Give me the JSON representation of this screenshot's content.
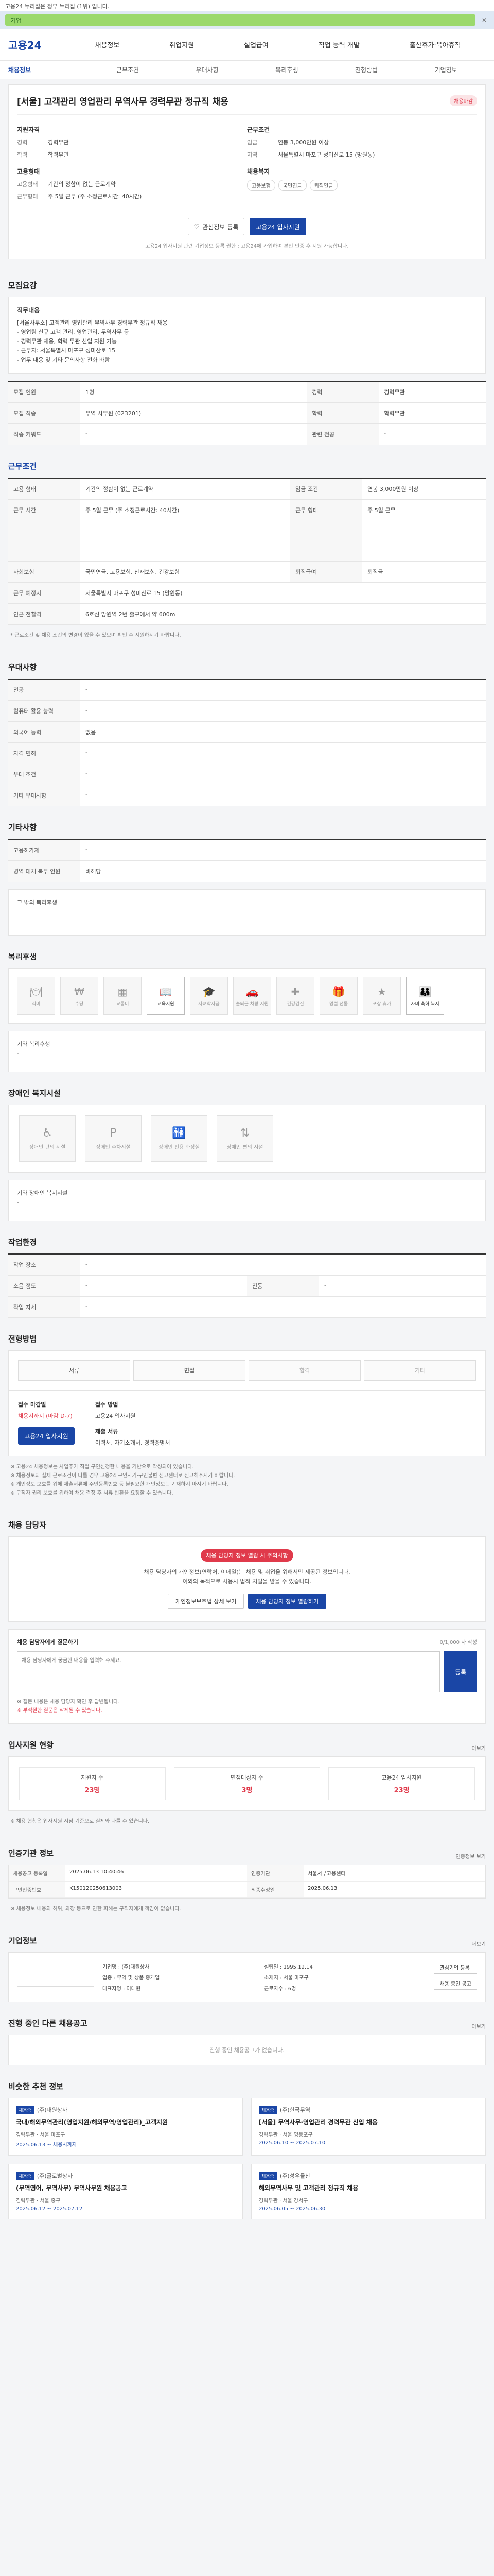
{
  "notice": "고용24 누리집은 정부 누리집 (1위) 입니다.",
  "ad": "기업",
  "header": {
    "logo": "고용24",
    "menu": [
      "채용정보",
      "취업지원",
      "실업급여",
      "직업 능력 개발",
      "출산휴가·육아휴직"
    ]
  },
  "subnav": [
    "채용정보",
    "근무조건",
    "우대사항",
    "복리후생",
    "전형방법",
    "기업정보"
  ],
  "job": {
    "title": "[서울] 고객관리 영업관리 무역사무 경력무관 정규직 채용",
    "badge": "채용마감",
    "left_title1": "지원자격",
    "left": [
      {
        "k": "경력",
        "v": "경력무관"
      },
      {
        "k": "학력",
        "v": "학력무관"
      }
    ],
    "left_title2": "고용형태",
    "left2": [
      {
        "k": "고용형태",
        "v": "기간의 정함이 없는 근로계약"
      },
      {
        "k": "근무형태",
        "v": "주 5일 근무 (주 소정근로시간: 40시간)"
      }
    ],
    "right_title1": "근무조건",
    "right": [
      {
        "k": "임금",
        "v": "연봉 3,000만원 이상"
      },
      {
        "k": "지역",
        "v": "서울특별시 마포구 성미산로 15 (망원동)"
      }
    ],
    "right_title2": "채용복지",
    "chips": [
      "고용보험",
      "국민연금",
      "퇴직연금"
    ],
    "btn_scrap": "관심정보 등록",
    "btn_apply": "고용24 입사지원",
    "note": "고용24 입사지원 관련 기업정보 등록 권한 : 고용24에 가입하여 본인 인증 후 지원 가능합니다."
  },
  "recruit": {
    "title": "모집요강",
    "head": "직무내용",
    "lines": [
      "[서울사무소] 고객관리 영업관리 무역사무 경력무관 정규직 채용",
      "- 영업팀 신규 고객 관리, 영업관리, 무역사무 등",
      "- 경력무관 채용, 학력 무관 신입 지원 가능",
      "- 근무지: 서울특별시 마포구 성미산로 15",
      "- 업무 내용 및 기타 문의사항 전화 바람"
    ],
    "rows": [
      {
        "k": "모집 인원",
        "v": "1명"
      },
      {
        "k": "모집 직종",
        "v": "무역 사무원 (023201)"
      },
      {
        "k": "직종 키워드",
        "v": "-"
      },
      {
        "k": "경력",
        "v": "경력무관"
      },
      {
        "k": "학력",
        "v": "학력무관"
      },
      {
        "k": "관련 전공",
        "v": "-"
      }
    ]
  },
  "cond": {
    "title": "근무조건",
    "rows": [
      {
        "k": "고용 형태",
        "v": "기간의 정함이 없는 근로계약"
      },
      {
        "k": "임금 조건",
        "v": "연봉 3,000만원 이상"
      },
      {
        "k": "근무 시간",
        "v": "주 5일 근무 (주 소정근로시간: 40시간)"
      },
      {
        "k": "근무 형태",
        "v": "주 5일 근무"
      },
      {
        "k": "근무 예정지",
        "v": "서울특별시 마포구 성미산로 15 (망원동)"
      },
      {
        "k": "인근 전철역",
        "v": "6호선 망원역 2번 출구에서 약 600m"
      },
      {
        "k": "사회보험",
        "v": "국민연금, 고용보험, 산재보험, 건강보험"
      },
      {
        "k": "퇴직급여",
        "v": "퇴직금"
      }
    ],
    "note": "* 근로조건 및 채용 조건의 변경이 있을 수 있으며 확인 후 지원하시기 바랍니다."
  },
  "pref": {
    "title": "우대사항",
    "rows": [
      {
        "k": "전공",
        "v": "-"
      },
      {
        "k": "컴퓨터 활용 능력",
        "v": "-"
      },
      {
        "k": "외국어 능력",
        "v": "없음"
      },
      {
        "k": "자격 면허",
        "v": "-"
      },
      {
        "k": "우대 조건",
        "v": "-"
      },
      {
        "k": "기타 우대사항",
        "v": "-"
      }
    ]
  },
  "etc": {
    "title": "기타사항",
    "rows": [
      {
        "k": "고용허가제",
        "v": "-"
      },
      {
        "k": "병역 대체 복무 인원",
        "v": "비해당"
      }
    ],
    "other": "그 밖의 복리후생"
  },
  "welfare": {
    "title": "복리후생",
    "items": [
      {
        "icon": "meal-icon",
        "label": "식비",
        "on": false
      },
      {
        "icon": "money-icon",
        "label": "수당",
        "on": false
      },
      {
        "icon": "building-icon",
        "label": "교통비",
        "on": false
      },
      {
        "icon": "book-icon",
        "label": "교육지원",
        "on": true
      },
      {
        "icon": "grad-icon",
        "label": "자녀학자금",
        "on": false
      },
      {
        "icon": "car-icon",
        "label": "출퇴근 차량 지원",
        "on": false
      },
      {
        "icon": "health-icon",
        "label": "건강검진",
        "on": false
      },
      {
        "icon": "gift-icon",
        "label": "명절 선물",
        "on": false
      },
      {
        "icon": "award-icon",
        "label": "포상 휴가",
        "on": false
      },
      {
        "icon": "family-icon",
        "label": "자녀 축하 복지",
        "on": true
      }
    ],
    "other_title": "기타 복리후생",
    "other_value": "-"
  },
  "disability": {
    "title": "장애인 복지시설",
    "items": [
      "장애인 편의 시설",
      "장애인 주차시설",
      "장애인 전용 화장실",
      "장애인 편의 시설"
    ],
    "other_title": "기타 장애인 복지시설",
    "other_value": "-"
  },
  "work": {
    "title": "작업환경",
    "rows": [
      {
        "k": "작업 장소",
        "v": "-"
      },
      {
        "k": "소음 정도",
        "v": "-"
      },
      {
        "k": "진동",
        "v": "-"
      },
      {
        "k": "작업 자세",
        "v": "-"
      }
    ]
  },
  "process": {
    "title": "전형방법",
    "steps": [
      "서류",
      "면접",
      "합격",
      "기타"
    ],
    "apply_label": "접수 마감일",
    "apply_value": "채용시까지 (마감 D-7)",
    "method_label": "접수 방법",
    "method_value": "고용24 입사지원",
    "btn": "고용24 입사지원",
    "docs_label": "제출 서류",
    "docs_value": "이력서, 자기소개서, 경력증명서",
    "notes": [
      "※ 고용24 채용정보는 사업주가 직접 구인신청한 내용을 기반으로 작성되어 있습니다.",
      "※ 채용정보와 실제 근로조건이 다를 경우 고용24 구인사기·구인불편 신고센터로 신고해주시기 바랍니다.",
      "※ 개인정보 보호를 위해 제출서류에 주민등록번호 등 불필요한 개인정보는 기재하지 마시기 바랍니다.",
      "※ 구직자 권리 보호를 위하여 채용 결정 후 서류 반환을 요청할 수 있습니다."
    ]
  },
  "manager": {
    "title": "채용 담당자",
    "alert": "채용 담당자 정보 열람 시 주의사항",
    "lines": [
      "채용 담당자의 개인정보(연락처, 이메일)는 채용 및 취업을 위해서만 제공된 정보입니다.",
      "이외의 목적으로 사용시 법적 처벌을 받을 수 있습니다."
    ],
    "btn1": "개인정보보호법 상세 보기",
    "btn2": "채용 담당자 정보 열람하기"
  },
  "qa": {
    "title": "채용 담당자에게 질문하기",
    "note_right": "0/1,000 자 작성",
    "placeholder": "채용 담당자에게 궁금한 내용을 입력해 주세요.",
    "submit": "등록",
    "notes": [
      "※ 질문 내용은 채용 담당자 확인 후 답변됩니다.",
      "※ 부적절한 질문은 삭제될 수 있습니다."
    ]
  },
  "stats": {
    "title": "입사지원 현황",
    "more": "더보기",
    "items": [
      {
        "l": "지원자 수",
        "n": "23명"
      },
      {
        "l": "면접대상자 수",
        "n": "3명"
      },
      {
        "l": "고용24 입사지원",
        "n": "23명"
      }
    ],
    "note": "※ 채용 현황은 입사지원 시점 기준으로 실제와 다를 수 있습니다."
  },
  "auth": {
    "title": "인증기관 정보",
    "btn": "인증정보 보기",
    "rows": [
      {
        "k": "채용공고 등록일",
        "v": "2025.06.13 10:40:46"
      },
      {
        "k": "인증기관",
        "v": "서울서부고용센터"
      },
      {
        "k": "구인인증번호",
        "v": "K150120250613003"
      },
      {
        "k": "최종수정일",
        "v": "2025.06.13"
      }
    ],
    "note": "※ 채용정보 내용의 허위, 과장 등으로 인한 피해는 구직자에게 책임이 없습니다."
  },
  "company": {
    "title": "기업정보",
    "more": "더보기",
    "rows": [
      {
        "k": "기업명",
        "v": "(주)대원상사"
      },
      {
        "k": "업종",
        "v": "무역 및 상품 중개업"
      },
      {
        "k": "대표자명",
        "v": "이대원"
      },
      {
        "k": "근로자수",
        "v": "6명"
      },
      {
        "k": "설립일",
        "v": "1995.12.14"
      },
      {
        "k": "소재지",
        "v": "서울 마포구"
      }
    ],
    "btns": [
      "관심기업 등록",
      "채용 중인 공고"
    ]
  },
  "other": {
    "title": "진행 중인 다른 채용공고",
    "more": "더보기",
    "empty": "진행 중인 채용공고가 없습니다."
  },
  "recs": {
    "title": "비슷한 추천 정보",
    "items": [
      {
        "tag": "채용중",
        "company": "(주)대원상사",
        "title": "국내/해외무역관리(영업지원/해외무역/영업관리)_고객지원",
        "meta": "경력무관 · 서울 마포구",
        "date": "2025.06.13 ~ 채용시까지"
      },
      {
        "tag": "채용중",
        "company": "(주)한국무역",
        "title": "[서울] 무역사무·영업관리 경력무관 신입 채용",
        "meta": "경력무관 · 서울 영등포구",
        "date": "2025.06.10 ~ 2025.07.10"
      },
      {
        "tag": "채용중",
        "company": "(주)글로벌상사",
        "title": "(무역영어, 무역사무) 무역사무원 채용공고",
        "meta": "경력무관 · 서울 중구",
        "date": "2025.06.12 ~ 2025.07.12"
      },
      {
        "tag": "채용중",
        "company": "(주)성우물산",
        "title": "해외무역사무 및 고객관리 정규직 채용",
        "meta": "경력무관 · 서울 강서구",
        "date": "2025.06.05 ~ 2025.06.30"
      }
    ]
  }
}
